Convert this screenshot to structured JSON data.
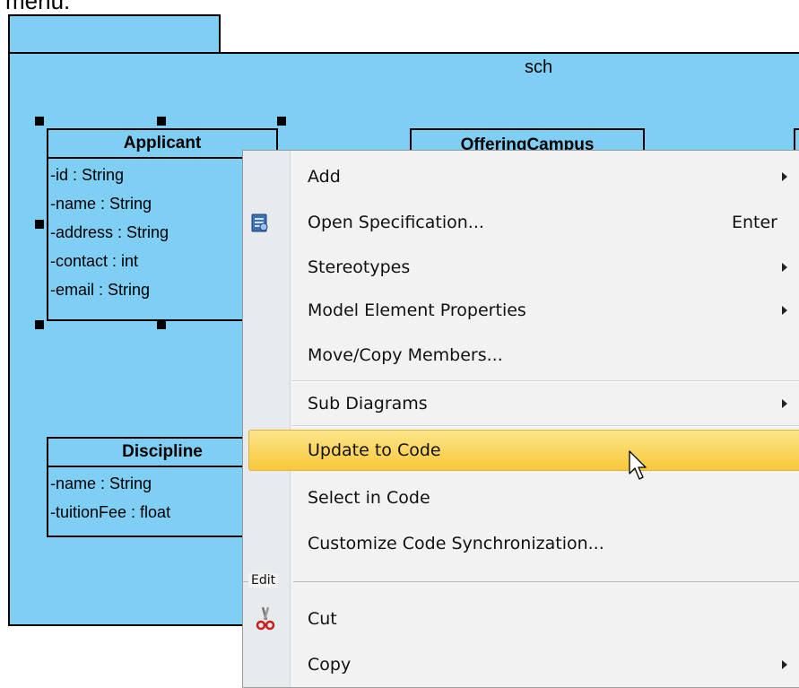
{
  "caption": {
    "text": "menu."
  },
  "package": {
    "name": "sch"
  },
  "classes": {
    "applicant": {
      "name": "Applicant",
      "attributes": [
        "-id : String",
        "-name : String",
        "-address : String",
        "-contact : int",
        "-email : String"
      ]
    },
    "offering_campus": {
      "name": "OfferingCampus"
    },
    "discipline": {
      "name": "Discipline",
      "attributes": [
        "-name : String",
        "-tuitionFee : float"
      ]
    }
  },
  "context_menu": {
    "items": [
      {
        "label": "Add",
        "submenu": true
      },
      {
        "label": "Open Specification...",
        "shortcut": "Enter",
        "icon": "specification-icon"
      },
      {
        "label": "Stereotypes",
        "submenu": true
      },
      {
        "label": "Model Element Properties",
        "submenu": true
      },
      {
        "label": "Move/Copy Members..."
      },
      {
        "label": "Sub Diagrams",
        "submenu": true
      },
      {
        "label": "Update to Code",
        "highlighted": true
      },
      {
        "label": "Select in Code"
      },
      {
        "label": "Customize Code Synchronization..."
      },
      {
        "label": "Cut",
        "icon": "scissors-icon"
      },
      {
        "label": "Copy",
        "submenu": true
      }
    ],
    "group_label": "Edit"
  },
  "colors": {
    "package_fill": "#7ecff3",
    "menu_background": "#f2f2f2",
    "highlight": "#f8c83a"
  }
}
